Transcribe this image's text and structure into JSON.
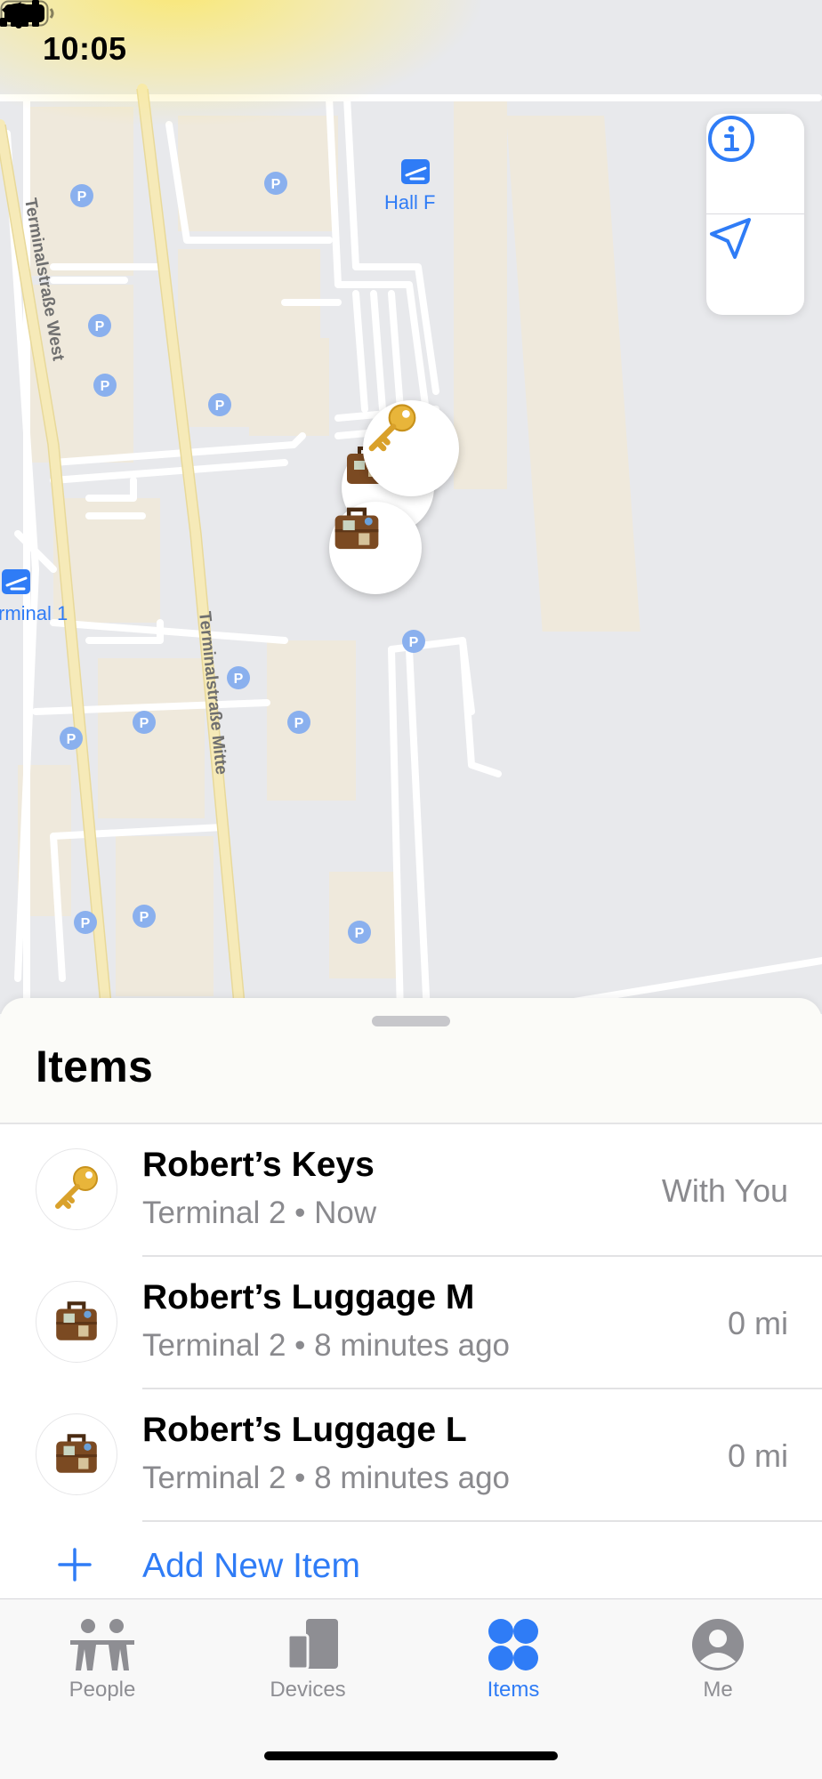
{
  "status_bar": {
    "time": "10:05"
  },
  "map": {
    "labels": {
      "hall_f": "Hall F",
      "terminal_1": "rminal 1",
      "street_west": "Terminalstraße West",
      "street_mitte": "Terminalstraße Mitte"
    },
    "parking_glyph": "P",
    "icons": {
      "info": "info-icon",
      "locate": "location-arrow-icon",
      "airport": "airport-icon"
    }
  },
  "sheet": {
    "title": "Items",
    "items": [
      {
        "name": "Robert’s Keys",
        "subtitle": "Terminal 2 • Now",
        "distance": "With You",
        "icon": "key-icon"
      },
      {
        "name": "Robert’s Luggage M",
        "subtitle": "Terminal 2 • 8 minutes ago",
        "distance": "0 mi",
        "icon": "luggage-icon"
      },
      {
        "name": "Robert’s Luggage L",
        "subtitle": "Terminal 2 • 8 minutes ago",
        "distance": "0 mi",
        "icon": "luggage-icon"
      }
    ],
    "add_item": "Add New Item"
  },
  "tab_bar": {
    "tabs": [
      {
        "label": "People",
        "icon": "people-icon"
      },
      {
        "label": "Devices",
        "icon": "devices-icon"
      },
      {
        "label": "Items",
        "icon": "items-icon",
        "active": true
      },
      {
        "label": "Me",
        "icon": "person-icon"
      }
    ]
  },
  "colors": {
    "accent": "#2f7cf6",
    "road": "#ffffff",
    "major_road": "#f8eec0",
    "building": "#efe9dc",
    "water_map": "#e8e9ec"
  }
}
